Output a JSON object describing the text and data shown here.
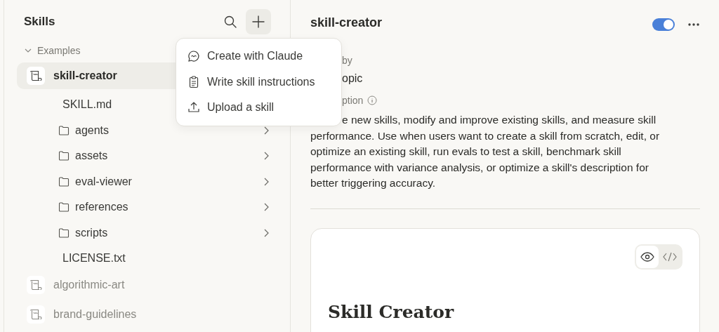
{
  "sidebar": {
    "title": "Skills",
    "section": {
      "label": "Examples",
      "expanded": true
    },
    "skills": [
      {
        "name": "skill-creator",
        "selected": true,
        "expanded": true,
        "children": [
          {
            "kind": "file",
            "name": "SKILL.md"
          },
          {
            "kind": "folder",
            "name": "agents",
            "expanded": false
          },
          {
            "kind": "folder",
            "name": "assets",
            "expanded": false
          },
          {
            "kind": "folder",
            "name": "eval-viewer",
            "expanded": false
          },
          {
            "kind": "folder",
            "name": "references",
            "expanded": false
          },
          {
            "kind": "folder",
            "name": "scripts",
            "expanded": false
          },
          {
            "kind": "file",
            "name": "LICENSE.txt"
          }
        ]
      },
      {
        "name": "algorithmic-art",
        "selected": false,
        "expanded": false
      },
      {
        "name": "brand-guidelines",
        "selected": false,
        "expanded": false
      }
    ]
  },
  "add_menu": [
    {
      "kind": "chat",
      "label": "Create with Claude"
    },
    {
      "kind": "clipboard",
      "label": "Write skill instructions"
    },
    {
      "kind": "upload",
      "label": "Upload a skill"
    }
  ],
  "detail": {
    "title": "skill-creator",
    "enabled": true,
    "added_by_label": "by",
    "author": "opic",
    "description_label": "ption",
    "description": "e new skills, modify and improve existing skills, and measure skill performance. Use when users want to create a skill from scratch, edit, or optimize an existing skill, run evals to test a skill, benchmark skill performance with variance analysis, or optimize a skill's description for better triggering accuracy.",
    "preview": {
      "views": [
        {
          "kind": "preview",
          "selected": true
        },
        {
          "kind": "code",
          "selected": false
        }
      ],
      "heading": "Skill Creator"
    }
  }
}
